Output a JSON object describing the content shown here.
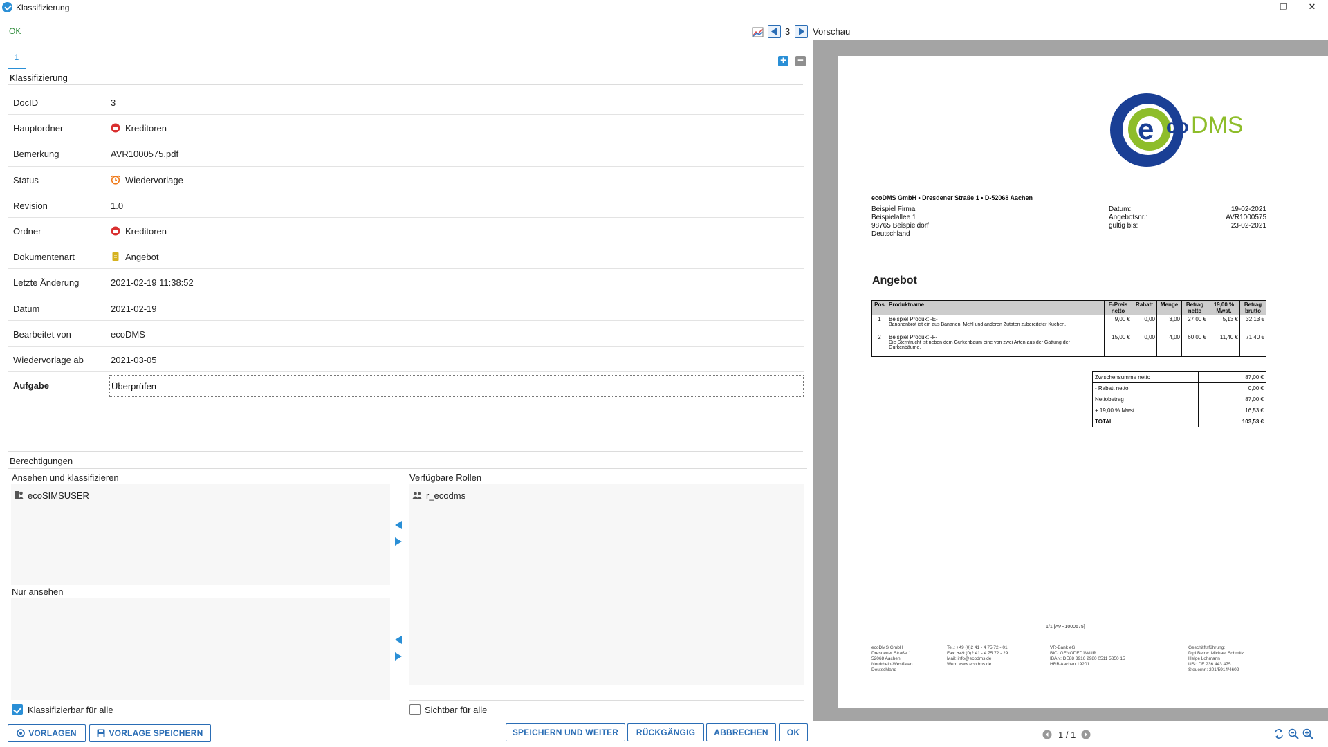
{
  "window": {
    "title": "Klassifizierung",
    "minimize": "—",
    "restore": "❐",
    "close": "✕"
  },
  "status": {
    "ok": "OK"
  },
  "tabs": [
    {
      "label": "1"
    }
  ],
  "section": {
    "title": "Klassifizierung"
  },
  "form": {
    "rows": [
      {
        "label": "DocID",
        "value": "3"
      },
      {
        "label": "Hauptordner",
        "value": "Kreditoren",
        "icon": "folder-red-icon"
      },
      {
        "label": "Bemerkung",
        "value": "AVR1000575.pdf"
      },
      {
        "label": "Status",
        "value": "Wiedervorlage",
        "icon": "alarm-clock-icon"
      },
      {
        "label": "Revision",
        "value": "1.0"
      },
      {
        "label": "Ordner",
        "value": "Kreditoren",
        "icon": "folder-red-icon"
      },
      {
        "label": "Dokumentenart",
        "value": "Angebot",
        "icon": "document-type-icon"
      },
      {
        "label": "Letzte Änderung",
        "value": "2021-02-19 11:38:52"
      },
      {
        "label": "Datum",
        "value": "2021-02-19"
      },
      {
        "label": "Bearbeitet von",
        "value": "ecoDMS"
      },
      {
        "label": "Wiedervorlage ab",
        "value": "2021-03-05"
      },
      {
        "label": "Aufgabe",
        "value": "Überprüfen"
      }
    ]
  },
  "permissions": {
    "title": "Berechtigungen",
    "view_classify_label": "Ansehen und klassifizieren",
    "view_classify_items": [
      "ecoSIMSUSER"
    ],
    "view_only_label": "Nur ansehen",
    "available_roles_label": "Verfügbare Rollen",
    "available_roles_items": [
      "r_ecodms"
    ],
    "classifiable_all_label": "Klassifizierbar für alle",
    "classifiable_all_checked": true,
    "visible_all_label": "Sichtbar für alle",
    "visible_all_checked": false
  },
  "buttons": {
    "templates": "VORLAGEN",
    "save_template": "VORLAGE SPEICHERN",
    "save_next": "SPEICHERN UND WEITER",
    "undo": "RÜCKGÄNGIG",
    "cancel": "ABBRECHEN",
    "ok": "OK"
  },
  "preview": {
    "label": "Vorschau",
    "doc_number": "3",
    "page_indicator": "1 / 1"
  },
  "document": {
    "logo_text_eco": "eco",
    "logo_text_dms": "DMS",
    "sender_line": "ecoDMS GmbH • Dresdener Straße 1 • D-52068 Aachen",
    "recipient": [
      "Beispiel Firma",
      "Beispielallee 1",
      "98765 Beispieldorf",
      "Deutschland"
    ],
    "meta": [
      {
        "key": "Datum:",
        "value": "19-02-2021"
      },
      {
        "key": "Angebotsnr.:",
        "value": "AVR1000575"
      },
      {
        "key": "gültig bis:",
        "value": "23-02-2021"
      }
    ],
    "heading": "Angebot",
    "table_headers": [
      "Pos",
      "Produktname",
      "E-Preis netto",
      "Rabatt",
      "Menge",
      "Betrag netto",
      "19,00 % Mwst.",
      "Betrag brutto"
    ],
    "items": [
      {
        "pos": "1",
        "name": "Beispiel Produkt -E-",
        "desc": "Bananenbrot ist ein aus Bananen, Mehl und anderen Zutaten zubereiteter Kuchen.",
        "price": "9,00 €",
        "discount": "0,00",
        "qty": "3,00",
        "net": "27,00 €",
        "vat": "5,13 €",
        "gross": "32,13 €"
      },
      {
        "pos": "2",
        "name": "Beispiel Produkt -F-",
        "desc": "Die Sternfrucht ist neben dem Gurkenbaum eine von zwei Arten aus der Gattung der Gurkenbäume.",
        "price": "15,00 €",
        "discount": "0,00",
        "qty": "4,00",
        "net": "60,00 €",
        "vat": "11,40 €",
        "gross": "71,40 €"
      }
    ],
    "summary": [
      {
        "key": "Zwischensumme netto",
        "value": "87,00 €"
      },
      {
        "key": "- Rabatt netto",
        "value": "0,00 €"
      },
      {
        "key": "Nettobetrag",
        "value": "87,00 €"
      },
      {
        "key": "+ 19,00 % Mwst.",
        "value": "16,53 €"
      },
      {
        "key": "TOTAL",
        "value": "103,53 €"
      }
    ],
    "page_ref": "1/1 [AVR1000575]",
    "footer_cols": [
      [
        "ecoDMS GmbH",
        "Dresdener Straße 1",
        "52068 Aachen",
        "Nordrhein-Westfalen",
        "Deutschland"
      ],
      [
        "Tel.: +49 (0)2 41 - 4 75 72 - 01",
        "Fax: +49 (0)2 41 - 4 75 72 - 29",
        "Mail: info@ecodms.de",
        "Web: www.ecodms.de"
      ],
      [
        "VR-Bank eG",
        "BIC: GENODED1WUR",
        "IBAN: DE88 3916 2980 0511 5850 15",
        "HRB Aachen 19201"
      ],
      [
        "Geschäftsführung:",
        "Dipl.Betrw. Michael Schmitz",
        "Helge Lohmann",
        "USt: DE 236 443 475",
        "Steuernr.: 201/5914/4602"
      ]
    ]
  },
  "colors": {
    "accent": "#2a8fd6",
    "button_border": "#2a6db5",
    "ok_green": "#2e8b3a",
    "preview_bg": "#a4a4a4",
    "logo_blue": "#1a3f95",
    "logo_green": "#8ebd2a"
  }
}
